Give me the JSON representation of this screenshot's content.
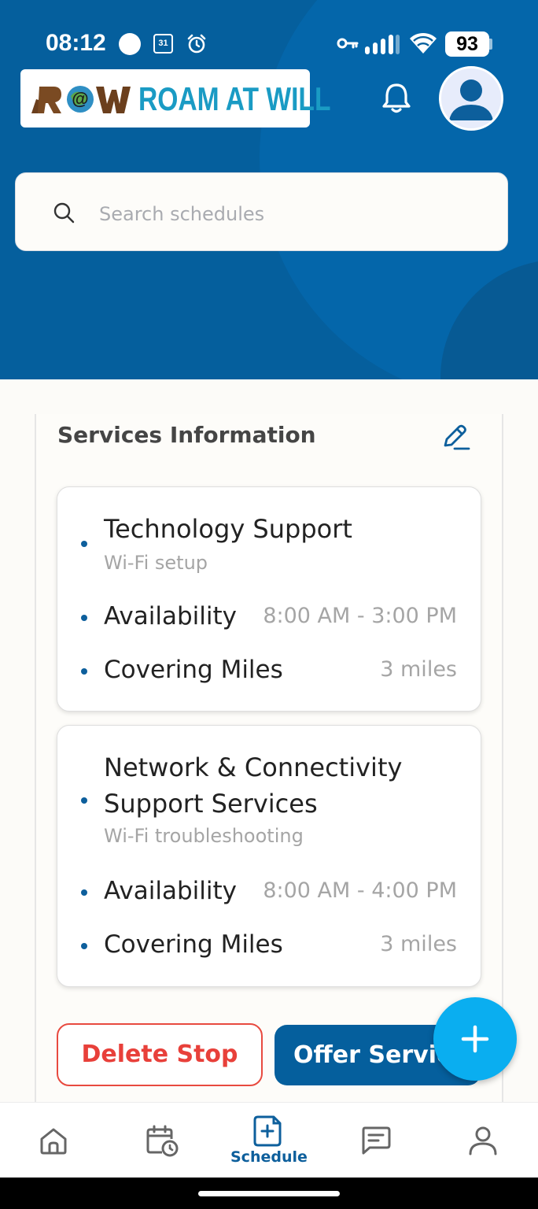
{
  "status_bar": {
    "time": "08:12",
    "calendar_day": "31",
    "battery": "93",
    "icons": [
      "record-dot-icon",
      "calendar-icon",
      "alarm-icon",
      "vpn-key-icon",
      "signal-icon",
      "wifi-icon",
      "battery-icon"
    ]
  },
  "header": {
    "logo_mark": "R@W",
    "logo_text": "ROAM AT WILL",
    "colors": {
      "background": "#055f9d",
      "logo_text": "#1a9bc4"
    }
  },
  "search": {
    "placeholder": "Search schedules",
    "icon": "search-icon"
  },
  "services_section": {
    "title": "Services Information",
    "edit_icon": "pencil-icon",
    "services": [
      {
        "name": "Technology Support",
        "description": "Wi-Fi setup",
        "availability_label": "Availability",
        "availability_value": "8:00 AM - 3:00 PM",
        "miles_label": "Covering Miles",
        "miles_value": "3 miles"
      },
      {
        "name": "Network & Connectivity Support Services",
        "description": "Wi-Fi troubleshooting",
        "availability_label": "Availability",
        "availability_value": "8:00 AM - 4:00 PM",
        "miles_label": "Covering Miles",
        "miles_value": "3 miles"
      }
    ]
  },
  "actions": {
    "delete_label": "Delete Stop",
    "offer_label": "Offer Servic",
    "fab_icon": "plus-icon",
    "colors": {
      "delete": "#e8403a",
      "offer": "#055f9d",
      "fab": "#0aaef0"
    }
  },
  "bottom_nav": {
    "items": [
      {
        "icon": "home-icon",
        "label": ""
      },
      {
        "icon": "calendar-clock-icon",
        "label": ""
      },
      {
        "icon": "schedule-add-icon",
        "label": "Schedule",
        "active": true
      },
      {
        "icon": "chat-icon",
        "label": ""
      },
      {
        "icon": "profile-icon",
        "label": ""
      }
    ]
  }
}
